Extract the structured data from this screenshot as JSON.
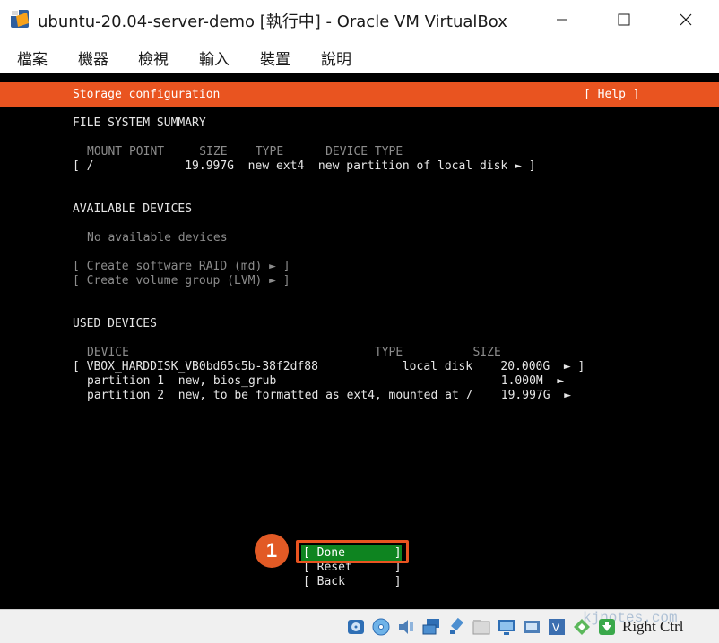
{
  "window": {
    "title": "ubuntu-20.04-server-demo [執行中] - Oracle VM VirtualBox",
    "app_icon": "virtualbox-icon"
  },
  "menu": {
    "items": [
      "檔案",
      "機器",
      "檢視",
      "輸入",
      "裝置",
      "說明"
    ]
  },
  "installer": {
    "header_title": "Storage configuration",
    "help_label": "[ Help ]",
    "fs_summary": {
      "heading": "FILE SYSTEM SUMMARY",
      "columns_line": "MOUNT POINT     SIZE    TYPE      DEVICE TYPE",
      "row": "[ /             19.997G  new ext4  new partition of local disk ► ]"
    },
    "available": {
      "heading": "AVAILABLE DEVICES",
      "empty_text": "No available devices",
      "raid_action": "[ Create software RAID (md) ► ]",
      "lvm_action": "[ Create volume group (LVM) ► ]"
    },
    "used": {
      "heading": "USED DEVICES",
      "columns_line": "DEVICE                                   TYPE          SIZE",
      "disk_row": "[ VBOX_HARDDISK_VB0bd65c5b-38f2df88            local disk    20.000G  ► ]",
      "partition1_row": "partition 1  new, bios_grub                                1.000M  ►",
      "partition2_row": "partition 2  new, to be formatted as ext4, mounted at /    19.997G  ►"
    },
    "buttons": {
      "done": "[ Done       ]",
      "reset": "[ Reset      ]",
      "back": "[ Back       ]"
    },
    "annotation_number": "1"
  },
  "statusbar": {
    "host_key": "Right Ctrl",
    "watermark": "kjnotes.com",
    "icons": [
      "hard-disk-icon",
      "optical-disk-icon",
      "audio-icon",
      "network-icon",
      "usb-icon",
      "shared-folder-icon",
      "display-icon",
      "video-capture-icon",
      "virtualization-icon",
      "mouse-integration-icon",
      "keyboard-capture-icon"
    ]
  },
  "colors": {
    "header": "#e95420",
    "done_highlight": "#0e8420",
    "annotation": "#e95420"
  }
}
